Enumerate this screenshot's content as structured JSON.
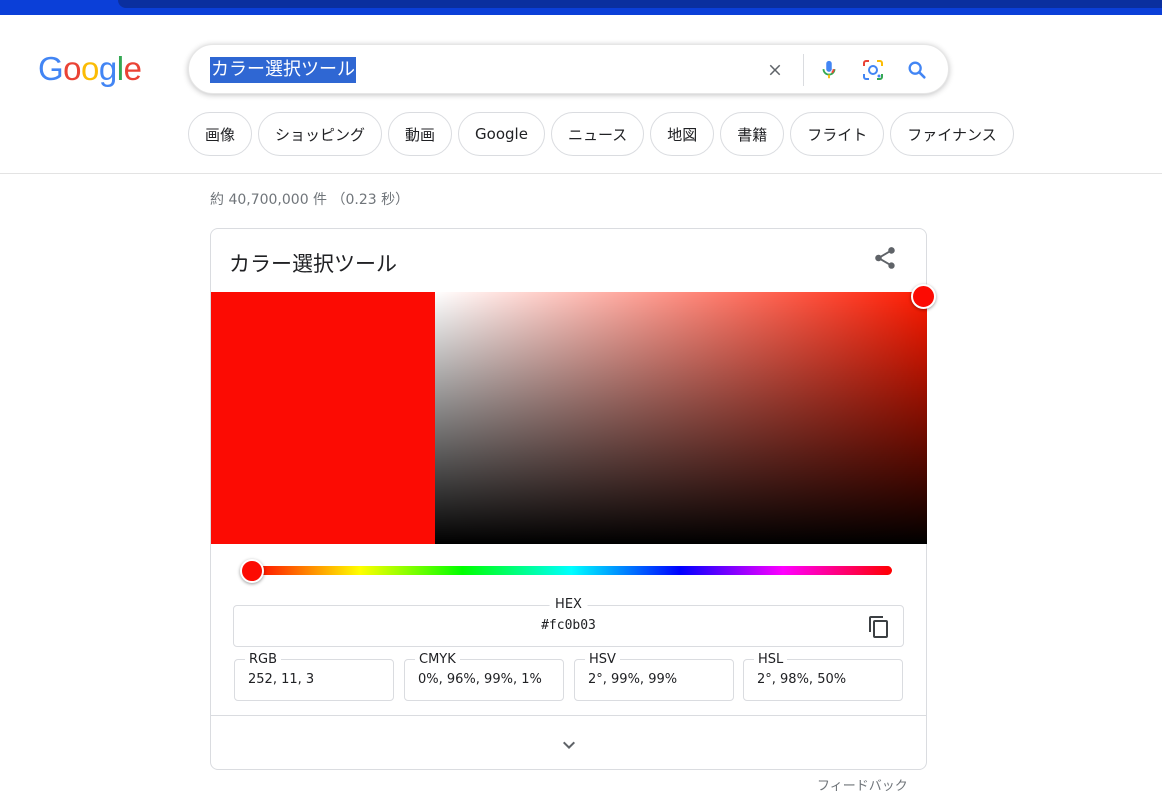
{
  "search": {
    "query": "カラー選択ツール"
  },
  "logo": {
    "letters": [
      "G",
      "o",
      "o",
      "g",
      "l",
      "e"
    ],
    "colors": [
      "#4285f4",
      "#ea4335",
      "#fbbc05",
      "#4285f4",
      "#34a853",
      "#ea4335"
    ]
  },
  "icons": {
    "clear": "close-icon",
    "voice": "mic-icon",
    "lens": "camera-lens-icon",
    "search": "search-icon",
    "share": "share-icon",
    "copy": "copy-icon",
    "expand": "chevron-down-icon"
  },
  "chips": [
    "画像",
    "ショッピング",
    "動画",
    "Google",
    "ニュース",
    "地図",
    "書籍",
    "フライト",
    "ファイナンス"
  ],
  "stats": "約 40,700,000 件 （0.23 秒）",
  "picker": {
    "title": "カラー選択ツール",
    "selected_color": "#fc0b03",
    "hue_fraction": 0.0,
    "hex_label": "HEX",
    "hex_value": "#fc0b03",
    "fields": [
      {
        "label": "RGB",
        "value": "252, 11, 3"
      },
      {
        "label": "CMYK",
        "value": "0%, 96%, 99%, 1%"
      },
      {
        "label": "HSV",
        "value": "2°, 99%, 99%"
      },
      {
        "label": "HSL",
        "value": "2°, 98%, 50%"
      }
    ]
  },
  "feedback_label": "フィードバック",
  "colors": {
    "accent": "#4285f4",
    "selection": "#2f67d3",
    "topbar": "#0b3fd8"
  }
}
